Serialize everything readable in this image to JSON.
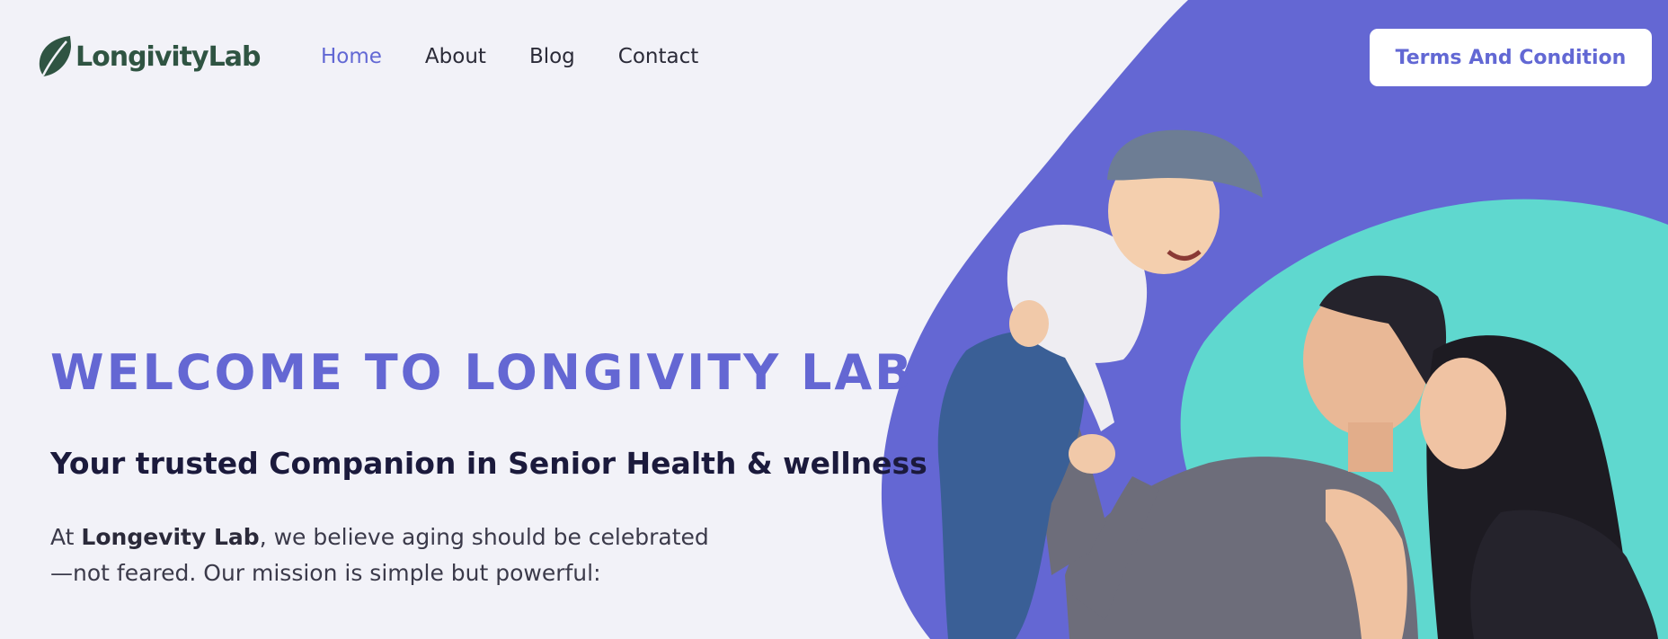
{
  "brand": {
    "name": "LongivityLab",
    "icon": "leaf-icon"
  },
  "nav": {
    "items": [
      {
        "label": "Home",
        "active": true
      },
      {
        "label": "About",
        "active": false
      },
      {
        "label": "Blog",
        "active": false
      },
      {
        "label": "Contact",
        "active": false
      }
    ]
  },
  "header": {
    "cta_label": "Terms And Condition"
  },
  "hero": {
    "title": "WELCOME TO LONGIVITY LAB",
    "subtitle": "Your trusted Companion in Senior Health & wellness",
    "body_prefix": "At ",
    "body_brand": "Longevity Lab",
    "body_line1_rest": ", we believe aging should be celebrated",
    "body_line2": "—not feared. Our mission is simple but powerful:"
  },
  "colors": {
    "background": "#f2f2f8",
    "accent_purple": "#6467d3",
    "accent_teal": "#5fd8cf",
    "brand_green": "#2f5442",
    "heading_dark": "#1b1a3c"
  }
}
